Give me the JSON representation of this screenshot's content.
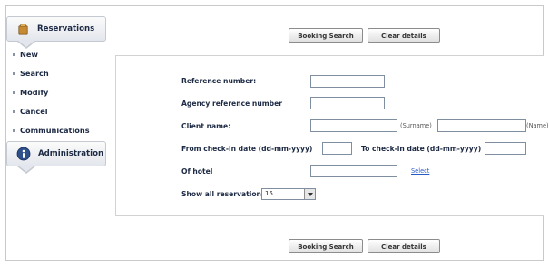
{
  "sidebar": {
    "reservations_title": "Reservations",
    "items": [
      {
        "label": "New"
      },
      {
        "label": "Search"
      },
      {
        "label": "Modify"
      },
      {
        "label": "Cancel"
      },
      {
        "label": "Communications"
      }
    ],
    "administration_title": "Administration"
  },
  "toolbar": {
    "search_label": "Booking Search",
    "clear_label": "Clear details"
  },
  "form": {
    "reference_label": "Reference number:",
    "agency_reference_label": "Agency reference number",
    "client_name_label": "Client name:",
    "surname_hint": "(Surname)",
    "name_hint": "(Name)",
    "checkin_from_label": "From check-in date (dd-mm-yyyy)",
    "checkin_to_label": "To check-in date (dd-mm-yyyy)",
    "hotel_label": "Of hotel",
    "select_link": "Select",
    "show_all_label": "Show all reservations",
    "show_all_value": "15"
  },
  "colors": {
    "text": "#1d2a44",
    "link": "#2a5cc8"
  }
}
